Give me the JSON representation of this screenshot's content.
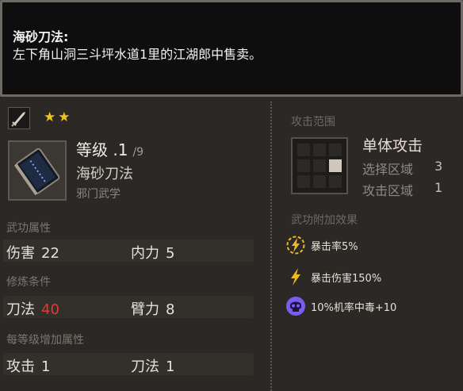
{
  "tooltip": {
    "title": "海砂刀法:",
    "description": "左下角山洞三斗坪水道1里的江湖郎中售卖。"
  },
  "skill": {
    "weapon_icon": "blade-icon",
    "stars": "★★",
    "level_label": "等级 .1",
    "level_max": "/9",
    "name": "海砂刀法",
    "school": "邪门武学",
    "book_icon": "book-icon"
  },
  "sections": {
    "attributes": "武功属性",
    "requirements": "修炼条件",
    "per_level": "每等级增加属性"
  },
  "attributes": [
    {
      "label": "伤害",
      "value": "22"
    },
    {
      "label": "内力",
      "value": "5"
    }
  ],
  "requirements": [
    {
      "label": "刀法",
      "value": "40",
      "status": "unmet"
    },
    {
      "label": "臂力",
      "value": "8"
    }
  ],
  "per_level": [
    {
      "label": "攻击",
      "value": "1"
    },
    {
      "label": "刀法",
      "value": "1"
    }
  ],
  "range": {
    "title": "攻击范围",
    "type": "单体攻击",
    "select_label": "选择区域",
    "select_value": "3",
    "attack_label": "攻击区域",
    "attack_value": "1"
  },
  "effects": {
    "title": "武功附加效果",
    "items": [
      {
        "icon": "lightning-circle-icon",
        "text": "暴击率5%"
      },
      {
        "icon": "lightning-icon",
        "text": "暴击伤害150%"
      },
      {
        "icon": "skull-icon",
        "text": "10%机率中毒+10"
      }
    ]
  },
  "colors": {
    "star": "#f0c21c",
    "unmet_requirement": "#e23a2f",
    "poison": "#7b5cf0",
    "crit": "#f0b820"
  }
}
